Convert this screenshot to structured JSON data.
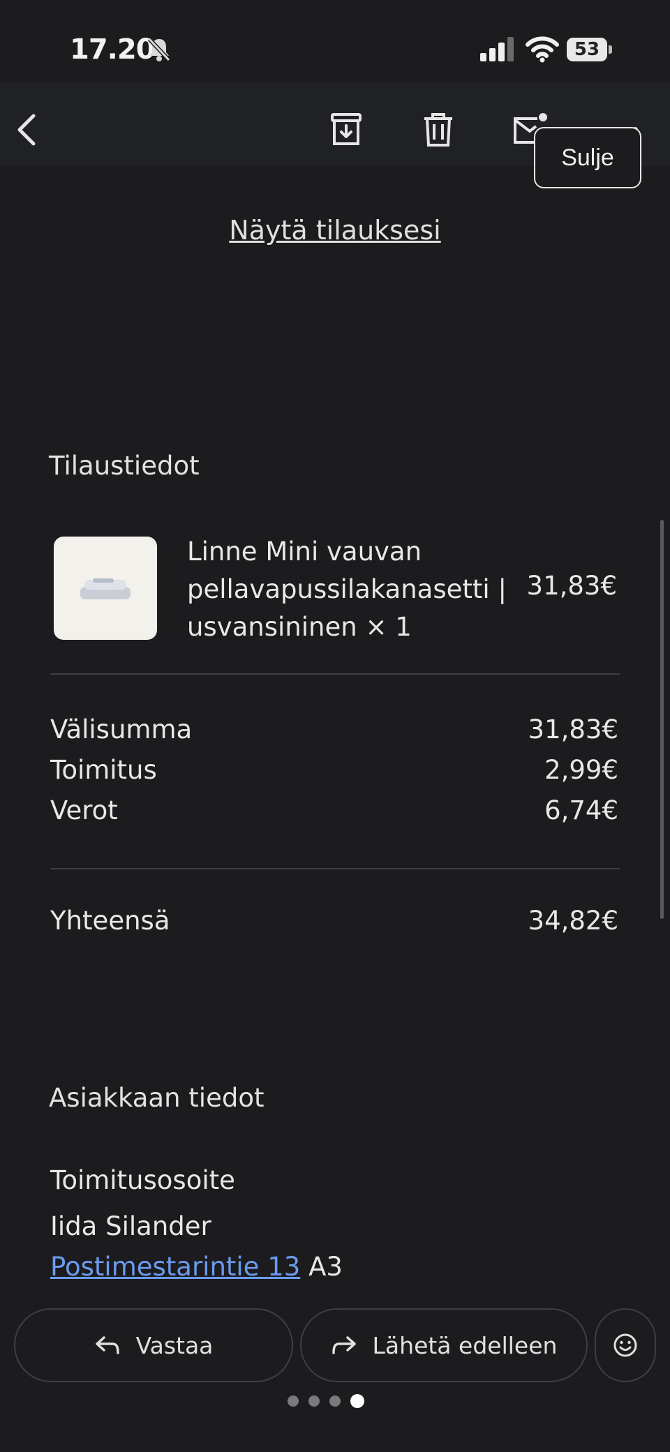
{
  "status_bar": {
    "time": "17.20",
    "battery": "53"
  },
  "toolbar": {
    "close_label": "Sulje"
  },
  "email": {
    "view_order_link": "Näytä tilauksesi",
    "order": {
      "title": "Tilaustiedot",
      "item": {
        "name_line1": "Linne Mini vauvan",
        "name_line2": "pellavapussilakanasetti |",
        "name_line3": "usvansininen × 1",
        "price": "31,83€"
      },
      "subtotal_label": "Välisumma",
      "subtotal_value": "31,83€",
      "shipping_label": "Toimitus",
      "shipping_value": "2,99€",
      "taxes_label": "Verot",
      "taxes_value": "6,74€",
      "total_label": "Yhteensä",
      "total_value": "34,82€"
    },
    "customer": {
      "title": "Asiakkaan tiedot",
      "shipping_address_label": "Toimitusosoite",
      "name": "Iida Silander",
      "street_link": "Postimestarintie 13",
      "street_suffix": "A3"
    }
  },
  "actions": {
    "reply_label": "Vastaa",
    "forward_label": "Lähetä edelleen"
  },
  "colors": {
    "background": "#1c1c1e",
    "link": "#6b9bf0",
    "text": "#e8e8e8"
  },
  "icons": [
    "bell-slash-icon",
    "signal-icon",
    "wifi-icon",
    "battery-icon",
    "back-arrow-icon",
    "archive-icon",
    "trash-icon",
    "mark-unread-icon",
    "more-icon",
    "reply-icon",
    "forward-icon",
    "emoji-icon"
  ]
}
